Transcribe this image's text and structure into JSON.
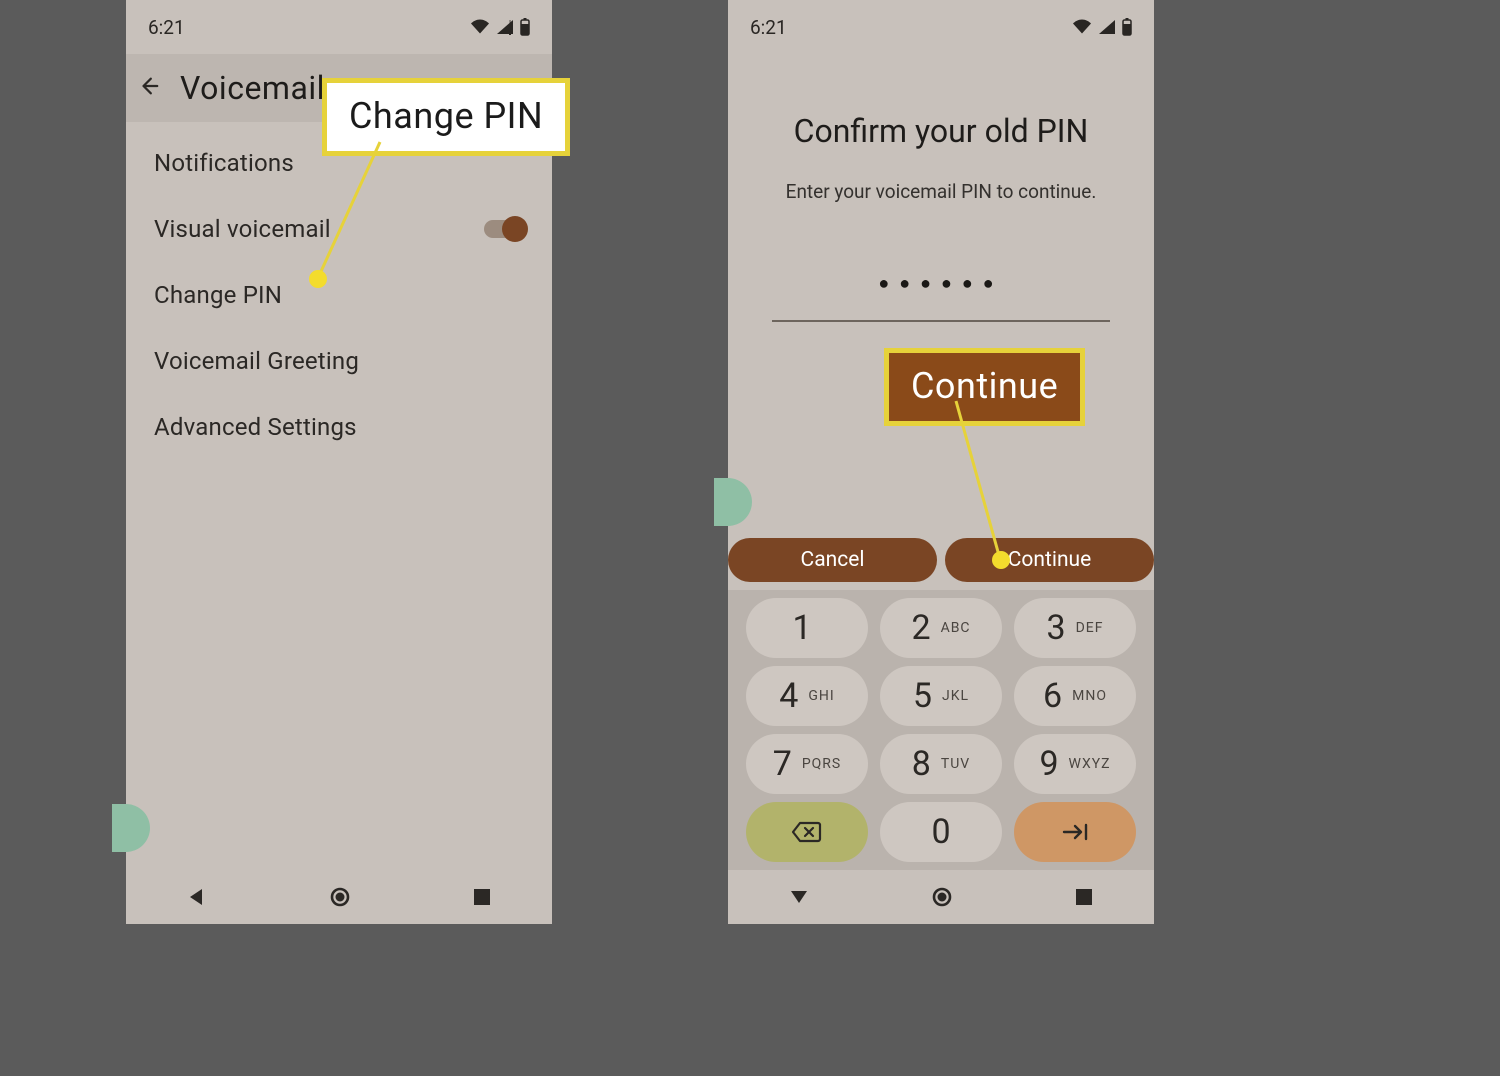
{
  "status": {
    "time": "6:21"
  },
  "left": {
    "appbar_title": "Voicemail",
    "items": [
      {
        "label": "Notifications"
      },
      {
        "label": "Visual voicemail",
        "toggle": true
      },
      {
        "label": "Change PIN"
      },
      {
        "label": "Voicemail Greeting"
      },
      {
        "label": "Advanced Settings"
      }
    ]
  },
  "callout_left": {
    "text": "Change PIN"
  },
  "right": {
    "title": "Confirm your old PIN",
    "subtitle": "Enter your voicemail PIN to continue.",
    "pin_masked": "●●●●●●",
    "cancel": "Cancel",
    "continue": "Continue",
    "keys": [
      {
        "d": "1",
        "l": ""
      },
      {
        "d": "2",
        "l": "ABC"
      },
      {
        "d": "3",
        "l": "DEF"
      },
      {
        "d": "4",
        "l": "GHI"
      },
      {
        "d": "5",
        "l": "JKL"
      },
      {
        "d": "6",
        "l": "MNO"
      },
      {
        "d": "7",
        "l": "PQRS"
      },
      {
        "d": "8",
        "l": "TUV"
      },
      {
        "d": "9",
        "l": "WXYZ"
      },
      {
        "d": "",
        "l": ""
      },
      {
        "d": "0",
        "l": ""
      },
      {
        "d": "",
        "l": ""
      }
    ]
  },
  "callout_right": {
    "text": "Continue"
  }
}
